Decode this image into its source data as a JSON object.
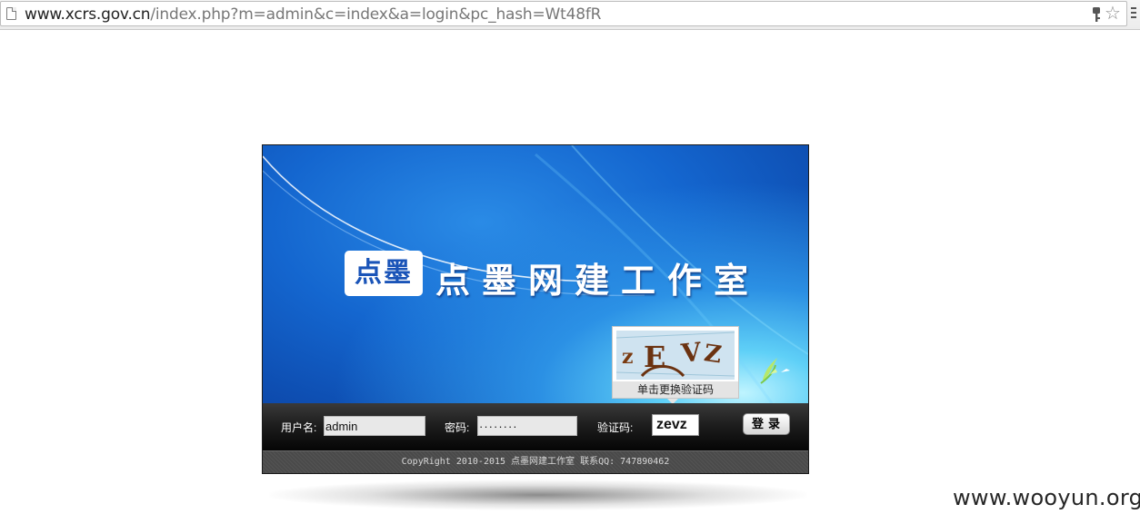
{
  "browser": {
    "url_host": "www.xcrs.gov.cn",
    "url_path": "/index.php?m=admin&c=index&a=login&pc_hash=Wt48fR",
    "icons": [
      "page-icon",
      "key-icon",
      "star-icon",
      "menu-icon"
    ]
  },
  "banner": {
    "logo_box_text": "点墨",
    "brand_name": "点墨网建工作室"
  },
  "captcha_popup": {
    "image_text": "zEVZ",
    "caption": "单击更换验证码"
  },
  "login": {
    "username_label": "用户名:",
    "username_value": "admin",
    "password_label": "密码:",
    "password_value": "········",
    "captcha_label": "验证码:",
    "captcha_value": "zevz",
    "submit_label": "登录"
  },
  "footer": {
    "copyright": "CopyRight 2010-2015 点墨网建工作室 联系QQ: 747890462"
  },
  "watermark": "www.wooyun.org"
}
